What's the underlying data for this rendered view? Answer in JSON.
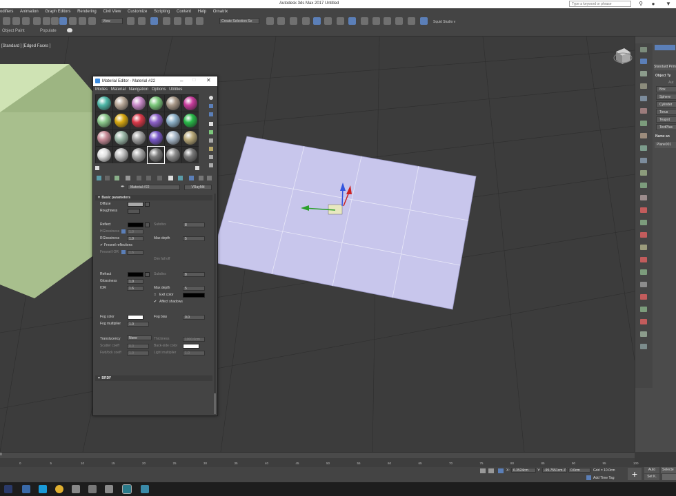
{
  "window": {
    "title": "Autodesk 3ds Max 2017     Untitled",
    "search_placeholder": "Type a keyword or phrase"
  },
  "menubar": [
    "odifiers",
    "Animation",
    "Graph Editors",
    "Rendering",
    "Civil View",
    "Customize",
    "Scripting",
    "Content",
    "Help",
    "Ornatrix"
  ],
  "toolbar": {
    "view_dropdown": "View",
    "selection_set": "Create Selection Se",
    "squid": "Squid Studio v"
  },
  "ribbon": {
    "object_paint": "Object Paint",
    "populate": "Populate"
  },
  "viewport": {
    "label": "[Standard ] [Edged Faces ]"
  },
  "command_panel": {
    "dropdown": "Standard Prim",
    "object_type_header": "Object Ty",
    "auto": "Aut",
    "buttons": [
      "Box",
      "Sphere",
      "Cylinder",
      "Torus",
      "Teapot",
      "TextPlus"
    ],
    "name_header": "Name an",
    "object_name": "Plane001"
  },
  "material_editor": {
    "title": "Material Editor - Material #22",
    "menu": [
      "Modes",
      "Material",
      "Navigation",
      "Options",
      "Utilities"
    ],
    "material_name": "Material #22",
    "material_type": "VRayMtl",
    "rollout_basic": "Basic parameters",
    "rollout_brdf": "BRDF",
    "labels": {
      "diffuse": "Diffuse",
      "roughness": "Roughness",
      "reflect": "Reflect",
      "subdivs": "Subdivs",
      "hglossiness": "HGlossiness",
      "rglossiness": "RGlossiness",
      "max_depth": "Max depth",
      "fresnel": "Fresnel reflections",
      "fresnel_ior": "Fresnel IOR",
      "dim_falloff": "Dim fall off",
      "refract": "Refract",
      "glossiness": "Glossiness",
      "ior": "IOR",
      "exit_color": "Exit color",
      "affect_shadows": "Affect shadows",
      "fog_color": "Fog color",
      "fog_bias": "Fog bias",
      "fog_multiplier": "Fog multiplier",
      "translucency": "Translucency",
      "translucency_value": "None",
      "thickness": "Thickness",
      "scatter_coeff": "Scatter coeff",
      "back_side_color": "Back-side color",
      "fwdbck_coeff": "Fwd/bck coeff",
      "light_multiplier": "Light multiplier"
    },
    "values": {
      "subdivs1": "8",
      "hglossiness": "1.0",
      "rglossiness": "1.0",
      "max_depth1": "5",
      "fresnel_ior": "1.6",
      "subdivs2": "8",
      "glossiness": "1.0",
      "ior": "1.6",
      "max_depth2": "5",
      "fog_bias": "0.0",
      "fog_multiplier": "1.0",
      "thickness": "1000.0cm",
      "scatter_coeff": "0.0",
      "fwdbck_coeff": "1.0",
      "light_multiplier": "1.0"
    },
    "sphere_colors": [
      "#4fb8a8",
      "#b8a898",
      "#c88ac8",
      "#7cc87c",
      "#a89888",
      "#c83c9c",
      "#8cc88c",
      "#d8a810",
      "#d83848",
      "#8c60c8",
      "#8cb0c8",
      "#28b848",
      "#c88c98",
      "#9cb8a8",
      "#a0a0a0",
      "#7858c8",
      "#a8b8c8",
      "#b8a878",
      "#e0e0e0",
      "#c0c0c0",
      "#a8a8a8",
      "#7c7c7c",
      "#8c8c8c",
      "#787878"
    ]
  },
  "timeline": {
    "ticks": [
      "0",
      "5",
      "10",
      "15",
      "20",
      "25",
      "30",
      "35",
      "40",
      "45",
      "50",
      "55",
      "60",
      "65",
      "70",
      "75",
      "80",
      "85",
      "90",
      "95",
      "100"
    ]
  },
  "status": {
    "x_label": "X:",
    "x": "6.3524cm",
    "y_label": "Y:",
    "y": "-95.7551cm",
    "z_label": "Z:",
    "z": "0.0cm",
    "grid": "Grid = 10.0cm",
    "add_time_tag": "Add Time Tag",
    "auto": "Auto",
    "set_k": "Set K.",
    "selected": "Selecte"
  }
}
